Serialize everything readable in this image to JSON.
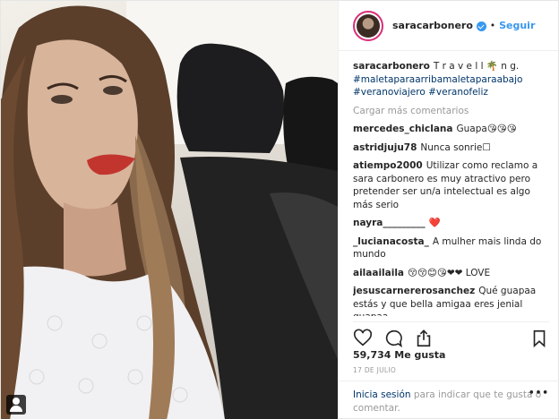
{
  "header": {
    "username": "saracarbonero",
    "separator": "•",
    "follow_label": "Seguir"
  },
  "comments": [
    {
      "user": "saracarbonero",
      "text": "T r a v e l l 🌴 n g.",
      "tags": "#maletaparaarribamaletaparaabajo #veranoviajero #veranofeliz"
    },
    {
      "user": "mercedes_chiclana",
      "text": "Guapa😘😘😘"
    },
    {
      "user": "astridjuju78",
      "text": "Nunca sonrie☐"
    },
    {
      "user": "atiempo2000",
      "text": "Utilizar como reclamo a sara carbonero es muy atractivo pero pretender ser un/a intelectual es algo más serio"
    },
    {
      "user": "nayra_________",
      "text": "❤️"
    },
    {
      "user": "_lucianacosta_",
      "text": "A mulher mais linda do mundo"
    },
    {
      "user": "ailaailaila",
      "text": "😚😚😊😘❤❤ LOVE"
    },
    {
      "user": "jesuscarnererosanchez",
      "text": "Qué guapaa estás y que bella amigaa eres jenial guapaa"
    }
  ],
  "load_more": "Cargar más comentarios",
  "likes": "59,734 Me gusta",
  "date": "17 DE JULIO",
  "login": {
    "link": "Inicia sesión",
    "text": "para indicar que te gusta o comentar."
  },
  "more_options": "•••",
  "icons": [
    "heart-icon",
    "comment-icon",
    "share-icon",
    "bookmark-icon"
  ]
}
